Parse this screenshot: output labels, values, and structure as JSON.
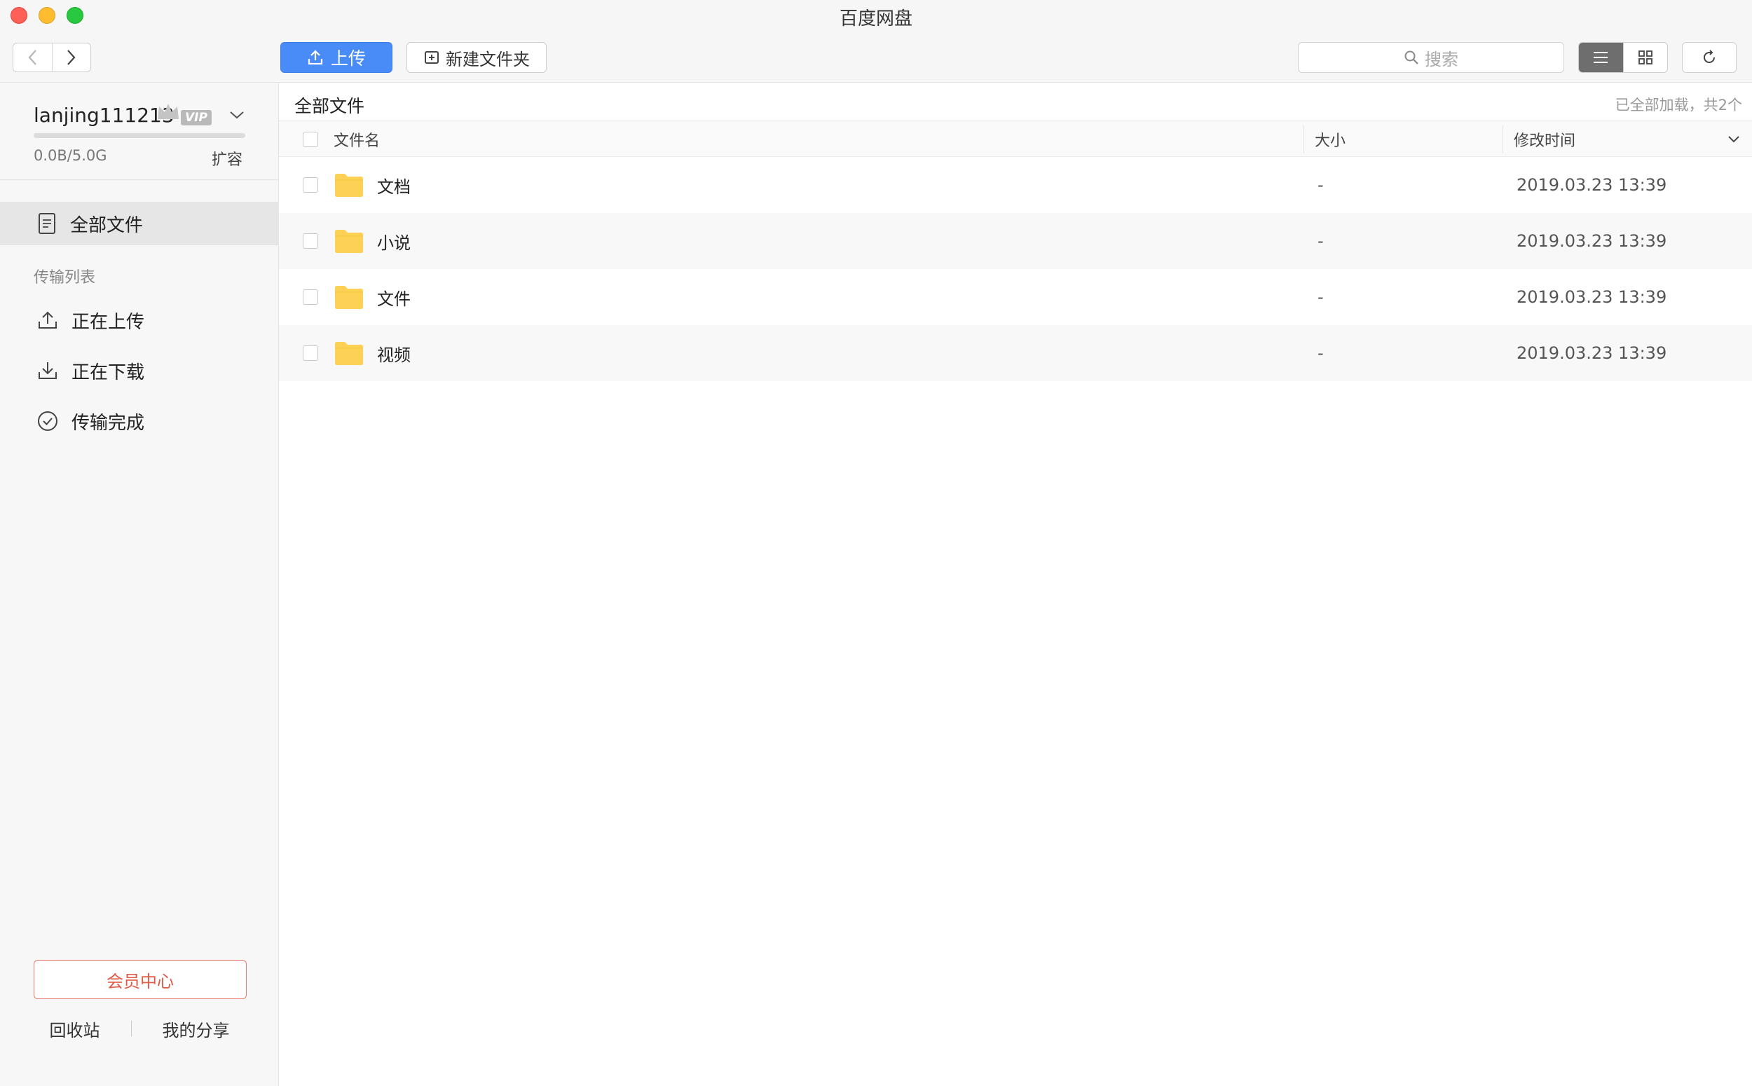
{
  "window": {
    "title": "百度网盘"
  },
  "toolbar": {
    "upload_label": "上传",
    "new_folder_label": "新建文件夹",
    "search_placeholder": "搜索"
  },
  "account": {
    "username": "lanjing111213",
    "vip_badge": "VIP",
    "quota_text": "0.0B/5.0G",
    "quota_fraction": 0.0,
    "expand_label": "扩容"
  },
  "sidebar": {
    "all_files": "全部文件",
    "transfer_section": "传输列表",
    "uploading": "正在上传",
    "downloading": "正在下载",
    "transfer_done": "传输完成",
    "vip_center": "会员中心",
    "recycle_bin": "回收站",
    "my_share": "我的分享"
  },
  "main": {
    "breadcrumb": "全部文件",
    "load_status": "已全部加载，共2个",
    "columns": {
      "name": "文件名",
      "size": "大小",
      "modified": "修改时间"
    },
    "files": [
      {
        "name": "文档",
        "size": "-",
        "modified": "2019.03.23 13:39"
      },
      {
        "name": "小说",
        "size": "-",
        "modified": "2019.03.23 13:39"
      },
      {
        "name": "文件",
        "size": "-",
        "modified": "2019.03.23 13:39"
      },
      {
        "name": "视频",
        "size": "-",
        "modified": "2019.03.23 13:39"
      }
    ]
  },
  "colors": {
    "accent": "#4a8cf7",
    "folder": "#fcd155",
    "vip_center": "#e05a46"
  },
  "icons": {
    "back": "chevron-left-icon",
    "forward": "chevron-right-icon",
    "upload": "upload-icon",
    "new_folder": "new-folder-icon",
    "search": "search-icon",
    "list_view": "list-view-icon",
    "grid_view": "grid-view-icon",
    "refresh": "refresh-icon",
    "all_files": "document-icon",
    "uploading": "upload-icon",
    "downloading": "download-icon",
    "transfer_done": "check-circle-icon",
    "folder": "folder-icon",
    "crown": "crown-icon",
    "dropdown": "chevron-down-icon"
  }
}
